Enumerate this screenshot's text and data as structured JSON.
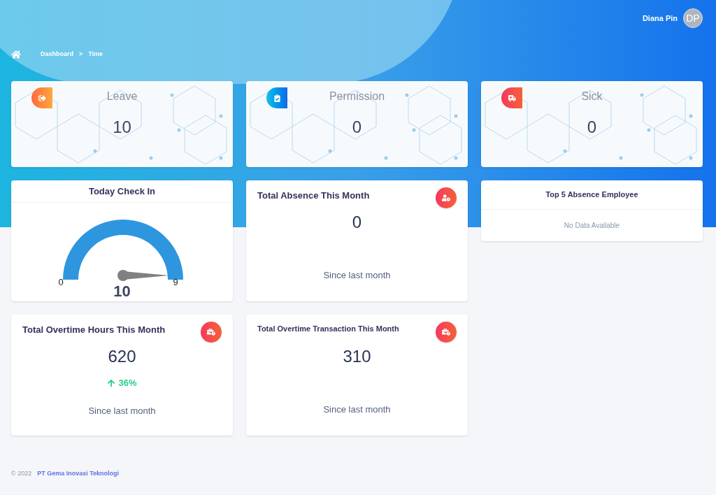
{
  "user": {
    "name": "Diana Pin",
    "initials": "DP"
  },
  "breadcrumb": [
    "Dashboard",
    "Time"
  ],
  "breadcrumb_separator": ">",
  "stat_cards": [
    {
      "kind": "leave",
      "label": "Leave",
      "value": "10"
    },
    {
      "kind": "permission",
      "label": "Permission",
      "value": "0"
    },
    {
      "kind": "sick",
      "label": "Sick",
      "value": "0"
    }
  ],
  "check_in": {
    "title": "Today Check In",
    "min": "0",
    "max": "9",
    "value": "10",
    "level": 1
  },
  "summary_cards": [
    {
      "kind": "absence",
      "title": "Total Absence This Month",
      "value": "0",
      "note": "Since last month"
    },
    {
      "kind": "overtime",
      "title": "Total Overtime Hours This Month",
      "value": "620",
      "change": "36%",
      "note": "Since last month"
    },
    {
      "kind": "overtime",
      "title": "Total Overtime Transaction This Month",
      "value": "310",
      "note": "Since last month"
    }
  ],
  "top_absence": {
    "title": "Top 5 Absence Employee",
    "empty": "No Data Available"
  },
  "footer": {
    "copyright": "© 2022",
    "company": "PT Gema Inovasi Teknologi"
  }
}
